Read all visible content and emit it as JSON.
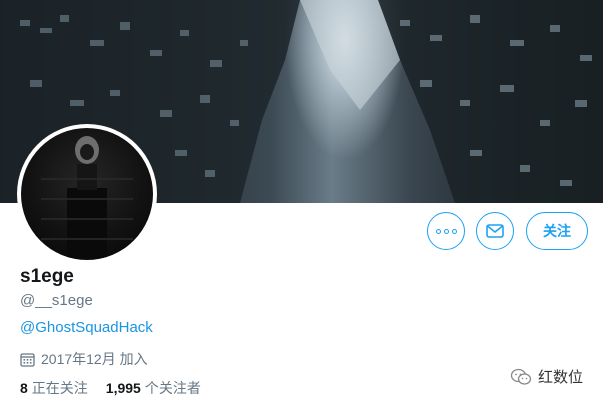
{
  "profile": {
    "display_name": "s1ege",
    "handle": "@__s1ege",
    "bio_link": "@GhostSquadHack",
    "joined": "2017年12月 加入",
    "following_count": "8",
    "following_label": "正在关注",
    "followers_count": "1,995",
    "followers_label": "个关注者"
  },
  "actions": {
    "follow_label": "关注"
  },
  "watermark": {
    "text": "红数位"
  },
  "colors": {
    "accent": "#1da1f2",
    "link": "#1b95e0",
    "muted": "#657786",
    "text": "#14171a"
  },
  "icons": [
    "more-icon",
    "mail-icon",
    "calendar-icon",
    "wechat-icon"
  ]
}
